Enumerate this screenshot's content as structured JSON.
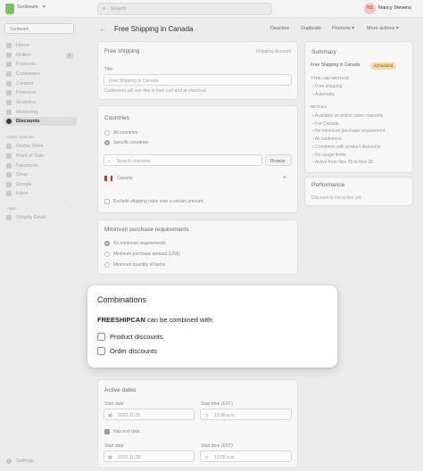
{
  "topbar": {
    "store_name": "Sunbeam",
    "search_placeholder": "Search",
    "user_initials": "NS",
    "user_name": "Nancy Stevens"
  },
  "sidebar": {
    "store_select": "Sunbeam",
    "items": [
      {
        "label": "Home",
        "icon": "home-icon"
      },
      {
        "label": "Orders",
        "icon": "orders-icon",
        "badge": "7"
      },
      {
        "label": "Products",
        "icon": "tag-icon"
      },
      {
        "label": "Customers",
        "icon": "person-icon"
      },
      {
        "label": "Content",
        "icon": "document-icon"
      },
      {
        "label": "Finances",
        "icon": "bank-icon"
      },
      {
        "label": "Analytics",
        "icon": "chart-icon"
      },
      {
        "label": "Marketing",
        "icon": "target-icon"
      },
      {
        "label": "Discounts",
        "icon": "discount-icon"
      }
    ],
    "channels_heading": "Sales channels",
    "channels": [
      {
        "label": "Online Store",
        "icon": "store-icon"
      },
      {
        "label": "Point of Sale",
        "icon": "pos-icon"
      },
      {
        "label": "Facebook",
        "icon": "facebook-icon"
      },
      {
        "label": "Shop",
        "icon": "shop-icon"
      },
      {
        "label": "Google",
        "icon": "google-icon"
      },
      {
        "label": "Inbox",
        "icon": "inbox-icon"
      }
    ],
    "apps_heading": "Apps",
    "apps": [
      {
        "label": "Shopify Email",
        "icon": "email-icon"
      }
    ],
    "settings": "Settings"
  },
  "header": {
    "title": "Free Shipping in Canada",
    "deactivate": "Deactive",
    "duplicate": "Duplicate",
    "promote": "Promote ▾",
    "more": "More actions ▾"
  },
  "free_shipping_card": {
    "heading": "Free shipping",
    "type_label": "Shipping discount",
    "title_label": "Title",
    "title_value": "Free Shipping in Canada",
    "help": "Customers will see this in their cart and at checkout."
  },
  "countries_card": {
    "heading": "Countries",
    "all_countries": "All countries",
    "specific_countries": "Specific countries",
    "search_placeholder": "Search countries",
    "browse": "Browse",
    "country": "Canada",
    "remove": "×",
    "exclude": "Exclude shipping rates over a certain amount"
  },
  "requirements_card": {
    "heading": "Minimum purchase requirements",
    "options": [
      "No minimum requirements",
      "Minimum purchase amount (US$)",
      "Minimum quantity of items"
    ]
  },
  "combinations": {
    "heading": "Combinations",
    "code": "FREESHIPCAN",
    "subtitle_rest": " can be combined with:",
    "options": [
      "Product discounts",
      "Order discounts"
    ]
  },
  "active_dates_card": {
    "heading": "Active dates",
    "start_date_label": "Start date",
    "start_date": "2022-11-25",
    "start_time_label": "Start time (EST)",
    "start_time": "12:00 a.m.",
    "has_end_date": "Has end date",
    "end_date_label": "Start date",
    "end_date": "2022-11-28",
    "end_time_label": "Start time (EST)",
    "end_time": "12:00 a.m."
  },
  "summary_card": {
    "heading": "Summary",
    "title": "Free Shipping in Canada",
    "status": "Scheduled",
    "type_heading": "TYPE AND METHOD",
    "type_items": [
      "Free shipping",
      "Automatic"
    ],
    "details_heading": "DETAILS",
    "details_items": [
      "Available on online sales channels",
      "For Canada",
      "No minimum purchase requirement",
      "All customers",
      "Combines with product discounts",
      "No usage limits",
      "Active from Nov 25 to Nov 28"
    ]
  },
  "performance_card": {
    "heading": "Performance",
    "text": "Discount is not active yet."
  },
  "colors": {
    "accent_status": "#f9d9a4",
    "canada_flag": "#d52b1e"
  }
}
